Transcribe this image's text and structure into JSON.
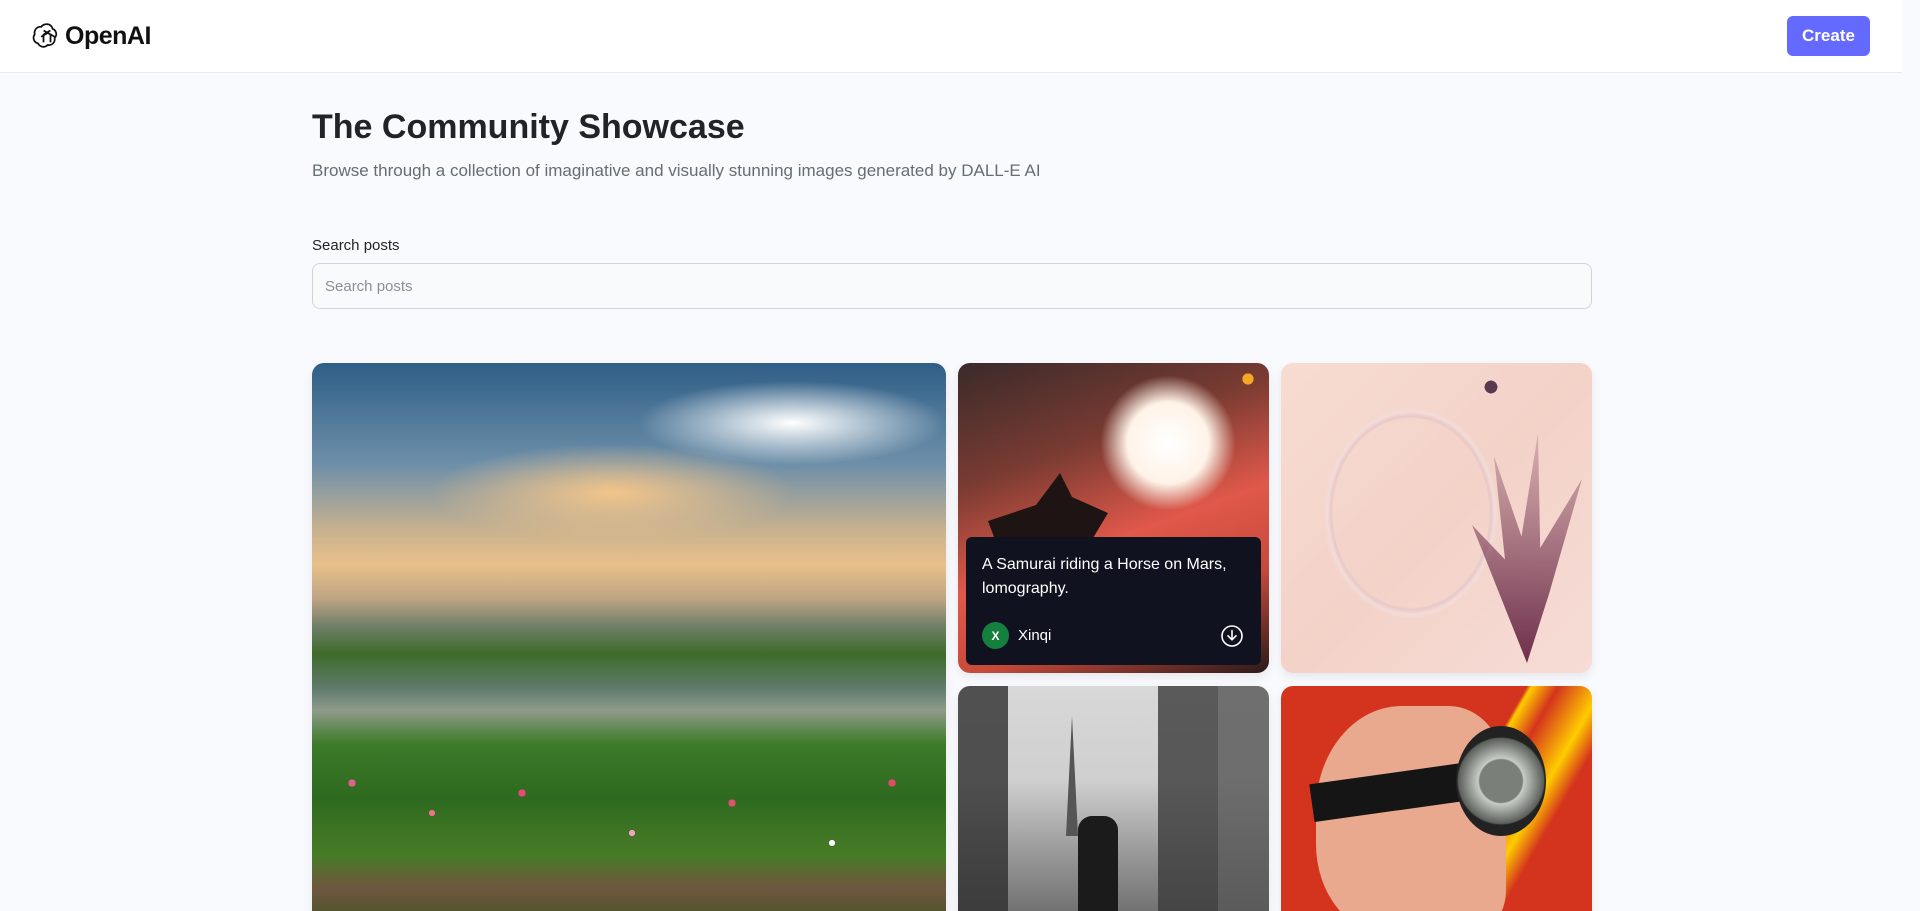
{
  "header": {
    "brand": "OpenAI",
    "create_label": "Create"
  },
  "main": {
    "title": "The Community Showcase",
    "subtitle": "Browse through a collection of imaginative and visually stunning images generated by DALL-E AI",
    "search": {
      "label": "Search posts",
      "placeholder": "Search posts",
      "value": ""
    }
  },
  "posts": [
    {
      "name": "landscape"
    },
    {
      "name": "samurai",
      "prompt": "A Samurai riding a Horse on Mars, lomography.",
      "author": "Xinqi",
      "author_initial": "X"
    },
    {
      "name": "pearls"
    },
    {
      "name": "city"
    },
    {
      "name": "hero"
    }
  ],
  "colors": {
    "accent": "#6469ff",
    "avatar": "#15803d",
    "overlay": "#10131f",
    "page_bg": "#f9fafe"
  }
}
